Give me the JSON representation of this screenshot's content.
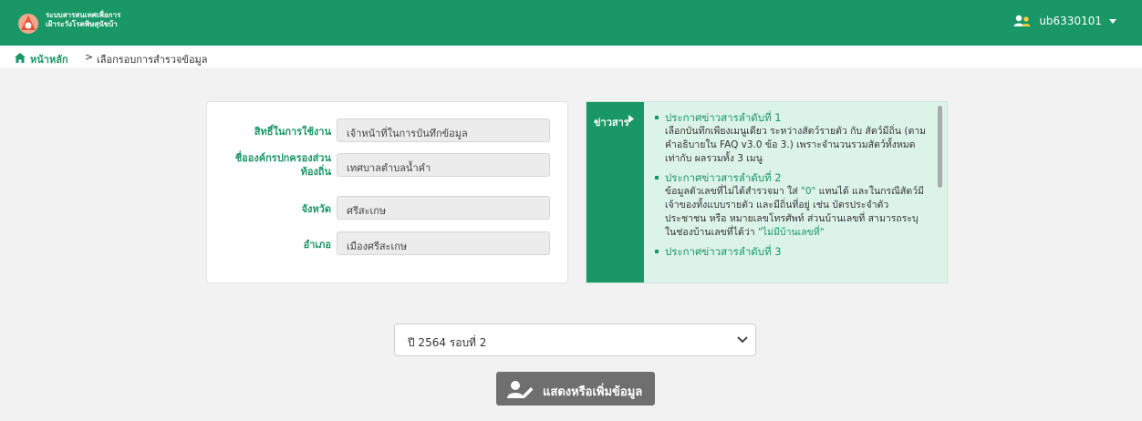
{
  "header": {
    "brand_line1": "ระบบสารสนเทศเพื่อการ",
    "brand_line2": "เฝ้าระวังโรคพิษสุนัขบ้า",
    "username": "ub6330101"
  },
  "breadcrumb": {
    "home": "หน้าหลัก",
    "separator": ">",
    "current": "เลือกรอบการสำรวจข้อมูล"
  },
  "form": {
    "rows": [
      {
        "label": "สิทธิ์ในการใช้งาน",
        "value": "เจ้าหน้าที่ในการบันทึกข้อมูล"
      },
      {
        "label_line1": "ชื่อองค์กรปกครองส่วน",
        "label_line2": "ท้องถิ่น",
        "value": "เทศบาลตำบลน้ำคำ"
      },
      {
        "label": "จังหวัด",
        "value": "ศรีสะเกษ"
      },
      {
        "label": "อำเภอ",
        "value": "เมืองศรีสะเกษ"
      }
    ]
  },
  "news": {
    "label": "ข่าวสาร",
    "items": [
      {
        "title": "ประกาศข่าวสารลำดับที่ 1",
        "body": "เลือกบันทึกเพียงเมนูเดียว ระหว่างสัตว์รายตัว กับ สัตว์มีถิ่น (ตามคำอธิบายใน FAQ v3.0 ข้อ 3.) เพราะจำนวนรวมสัตว์ทั้งหมด เท่ากับ ผลรวมทั้ง 3 เมนู"
      },
      {
        "title": "ประกาศข่าวสารลำดับที่ 2",
        "body_a": "ข้อมูลตัวเลขที่ไม่ได้สำรวจมา ใส่ ",
        "body_hl1": "\"0\"",
        "body_b": " แทนได้ และในกรณีสัตว์มีเจ้าของทั้งแบบรายตัว และมีถิ่นที่อยู่ เช่น บัตรประจำตัวประชาชน หรือ หมายเลขโทรศัพท์ ส่วนบ้านเลขที่ สามารถระบุในช่องบ้านเลขที่ได้ว่า ",
        "body_hl2": "\"ไม่มีบ้านเลขที่\""
      },
      {
        "title": "ประกาศข่าวสารลำดับที่ 3"
      }
    ]
  },
  "round_select": {
    "selected": "ปี 2564 รอบที่ 2"
  },
  "show_button": {
    "label": "แสดงหรือเพิ่มข้อมูล"
  },
  "colors": {
    "primary_green": "#1a9766",
    "news_bg": "#dcf3ea",
    "button_gray": "#6f6f6f"
  }
}
